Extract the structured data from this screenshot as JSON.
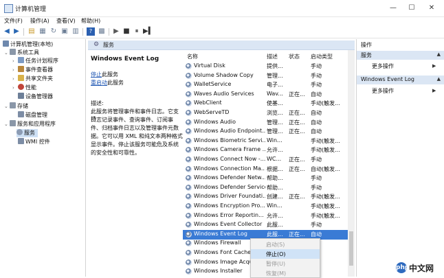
{
  "window": {
    "title": "计算机管理",
    "minimize": "—",
    "maximize": "☐",
    "close": "✕"
  },
  "menu": [
    "文件(F)",
    "操作(A)",
    "查看(V)",
    "帮助(H)"
  ],
  "tree": {
    "root": "计算机管理(本地)",
    "system_tools": "系统工具",
    "task_scheduler": "任务计划程序",
    "event_viewer": "事件查看器",
    "shared_folders": "共享文件夹",
    "performance": "性能",
    "device_manager": "设备管理器",
    "storage": "存储",
    "disk_management": "磁盘管理",
    "services_apps": "服务和应用程序",
    "services": "服务",
    "wmi": "WMI 控件"
  },
  "mid_header": {
    "label": "服务"
  },
  "description_panel": {
    "service_name": "Windows Event Log",
    "stop_link": "停止",
    "stop_suffix": "此服务",
    "restart_link": "重启动",
    "restart_suffix": "此服务",
    "desc_label": "描述:",
    "desc_lines": [
      "此服务将管理事件和事件日志。它支持",
      "日志记录事件、查询事件、订阅事",
      "件、归档事件日志以及管理事件元数",
      "据。它可以用 XML 和纯文本两种格式",
      "显示事件。停止该服务可能危及系统",
      "的安全性和可靠性。"
    ]
  },
  "table": {
    "headers": {
      "name": "名称",
      "desc": "描述",
      "status": "状态",
      "startup": "启动类型"
    },
    "rows": [
      {
        "name": "Virtual Disk",
        "desc": "提供...",
        "status": "",
        "startup": "手动"
      },
      {
        "name": "Volume Shadow Copy",
        "desc": "管理...",
        "status": "",
        "startup": "手动"
      },
      {
        "name": "WalletService",
        "desc": "电子...",
        "status": "",
        "startup": "手动"
      },
      {
        "name": "Waves Audio Services",
        "desc": "Wav...",
        "status": "正在...",
        "startup": "自动"
      },
      {
        "name": "WebClient",
        "desc": "使基...",
        "status": "",
        "startup": "手动(触发..."
      },
      {
        "name": "WebServeTD",
        "desc": "浏览...",
        "status": "正在...",
        "startup": "自动"
      },
      {
        "name": "Windows Audio",
        "desc": "管理...",
        "status": "正在...",
        "startup": "自动"
      },
      {
        "name": "Windows Audio Endpoint...",
        "desc": "管理...",
        "status": "正在...",
        "startup": "自动"
      },
      {
        "name": "Windows Biometric Servi...",
        "desc": "Win...",
        "status": "",
        "startup": "手动(触发..."
      },
      {
        "name": "Windows Camera Frame ...",
        "desc": "允许...",
        "status": "",
        "startup": "手动(触发..."
      },
      {
        "name": "Windows Connect Now -...",
        "desc": "WC...",
        "status": "正在...",
        "startup": "手动"
      },
      {
        "name": "Windows Connection Ma...",
        "desc": "根据...",
        "status": "正在...",
        "startup": "自动(触发..."
      },
      {
        "name": "Windows Defender Netw...",
        "desc": "帮助...",
        "status": "",
        "startup": "手动"
      },
      {
        "name": "Windows Defender Service",
        "desc": "帮助...",
        "status": "",
        "startup": "手动"
      },
      {
        "name": "Windows Driver Foundati...",
        "desc": "创建...",
        "status": "正在...",
        "startup": "手动(触发..."
      },
      {
        "name": "Windows Encryption Pro...",
        "desc": "Win...",
        "status": "",
        "startup": "手动(触发..."
      },
      {
        "name": "Windows Error Reportin...",
        "desc": "允许...",
        "status": "",
        "startup": "手动(触发..."
      },
      {
        "name": "Windows Event Collector",
        "desc": "此服...",
        "status": "",
        "startup": "手动"
      },
      {
        "name": "Windows Event Log",
        "desc": "此服...",
        "status": "正在...",
        "startup": "自动"
      },
      {
        "name": "Windows Firewall",
        "desc": "",
        "status": "",
        "startup": ""
      },
      {
        "name": "Windows Font Cache S",
        "desc": "",
        "status": "",
        "startup": ""
      },
      {
        "name": "Windows Image Acqu",
        "desc": "",
        "status": "",
        "startup": ""
      },
      {
        "name": "Windows Installer",
        "desc": "",
        "status": "",
        "startup": ""
      }
    ]
  },
  "actions": {
    "header": "操作",
    "group1_title": "服务",
    "group1_item": "更多操作",
    "group2_title": "Windows Event Log",
    "group2_item": "更多操作"
  },
  "context_menu": [
    {
      "label": "启动(S)",
      "disabled": true
    },
    {
      "label": "停止(O)",
      "disabled": false
    },
    {
      "label": "暂停(U)",
      "disabled": true
    },
    {
      "label": "恢复(M)",
      "disabled": true
    }
  ],
  "watermark": {
    "logo": "php",
    "text": "中文网"
  }
}
